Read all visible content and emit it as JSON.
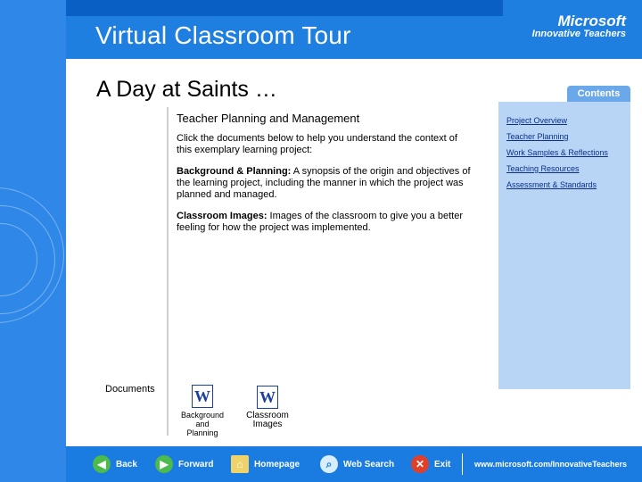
{
  "header": {
    "title": "Virtual Classroom Tour",
    "brand_line1": "Microsoft",
    "brand_line2": "Innovative Teachers"
  },
  "page": {
    "title": "A Day at Saints …",
    "section_heading": "Teacher Planning and Management",
    "intro": "Click the documents below to help you understand the context of this exemplary learning project:",
    "item1_label": "Background & Planning:",
    "item1_text": "A synopsis of the origin and objectives of the learning project, including the manner in which the project was planned and managed.",
    "item2_label": "Classroom Images:",
    "item2_text": "Images of the classroom to give you a better feeling for how the project was implemented.",
    "documents_label": "Documents",
    "doc1_caption": "Background and Planning",
    "doc2_caption": "Classroom Images"
  },
  "contents": {
    "tab_label": "Contents",
    "links": [
      "Project Overview",
      "Teacher Planning",
      "Work Samples & Reflections",
      "Teaching Resources",
      "Assessment & Standards"
    ]
  },
  "footer": {
    "back": "Back",
    "forward": "Forward",
    "homepage": "Homepage",
    "web_search": "Web Search",
    "exit": "Exit",
    "url": "www.microsoft.com/InnovativeTeachers"
  },
  "colors": {
    "header_blue": "#1f7fe0",
    "panel_light": "#b8d5f5",
    "link": "#0d2f8a"
  }
}
